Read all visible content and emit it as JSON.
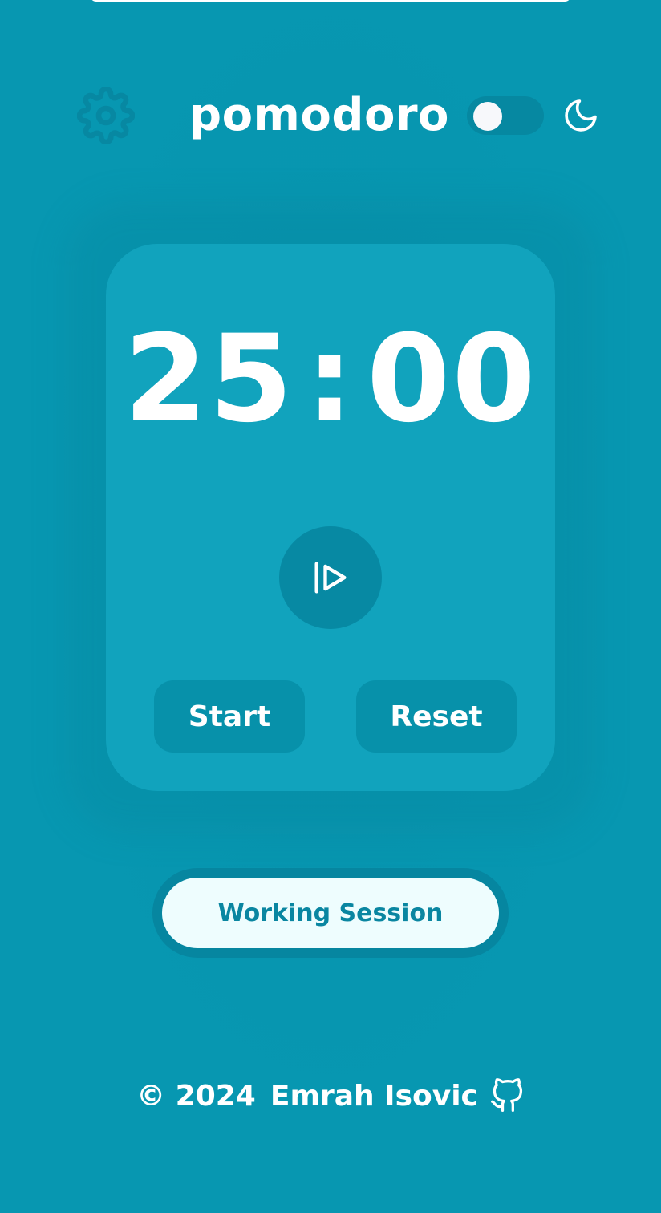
{
  "app": {
    "title": "pomodoro"
  },
  "header": {
    "settings_icon": "gear-icon",
    "theme_toggle": {
      "state": "off"
    },
    "theme_icon": "moon-icon"
  },
  "timer": {
    "minutes": "25",
    "separator": ":",
    "seconds": "00",
    "play_icon": "play-pause-icon"
  },
  "controls": {
    "start_label": "Start",
    "reset_label": "Reset"
  },
  "session": {
    "label": "Working Session"
  },
  "footer": {
    "copyright": "© 2024",
    "author": "Emrah Isovic",
    "link_icon": "github-icon"
  },
  "colors": {
    "background": "#0797b1",
    "card": "#11a3bd",
    "button": "#0791aa",
    "session_pill": "#eefdfe",
    "session_text": "#0a86a1"
  }
}
